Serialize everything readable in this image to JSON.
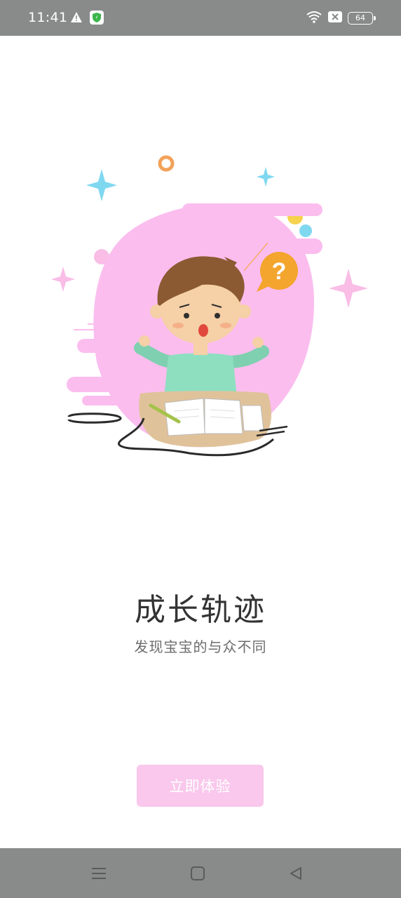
{
  "status_bar": {
    "time": "11:41",
    "battery": "64",
    "icons": [
      "warning-icon",
      "shield-icon",
      "wifi-icon",
      "sim-off-icon",
      "battery-icon"
    ]
  },
  "onboarding": {
    "title": "成长轨迹",
    "subtitle": "发现宝宝的与众不同",
    "cta_label": "立即体验",
    "accent_color": "#f9c8ec"
  },
  "nav_bar": {
    "icons": [
      "menu-icon",
      "home-icon",
      "back-icon"
    ]
  }
}
